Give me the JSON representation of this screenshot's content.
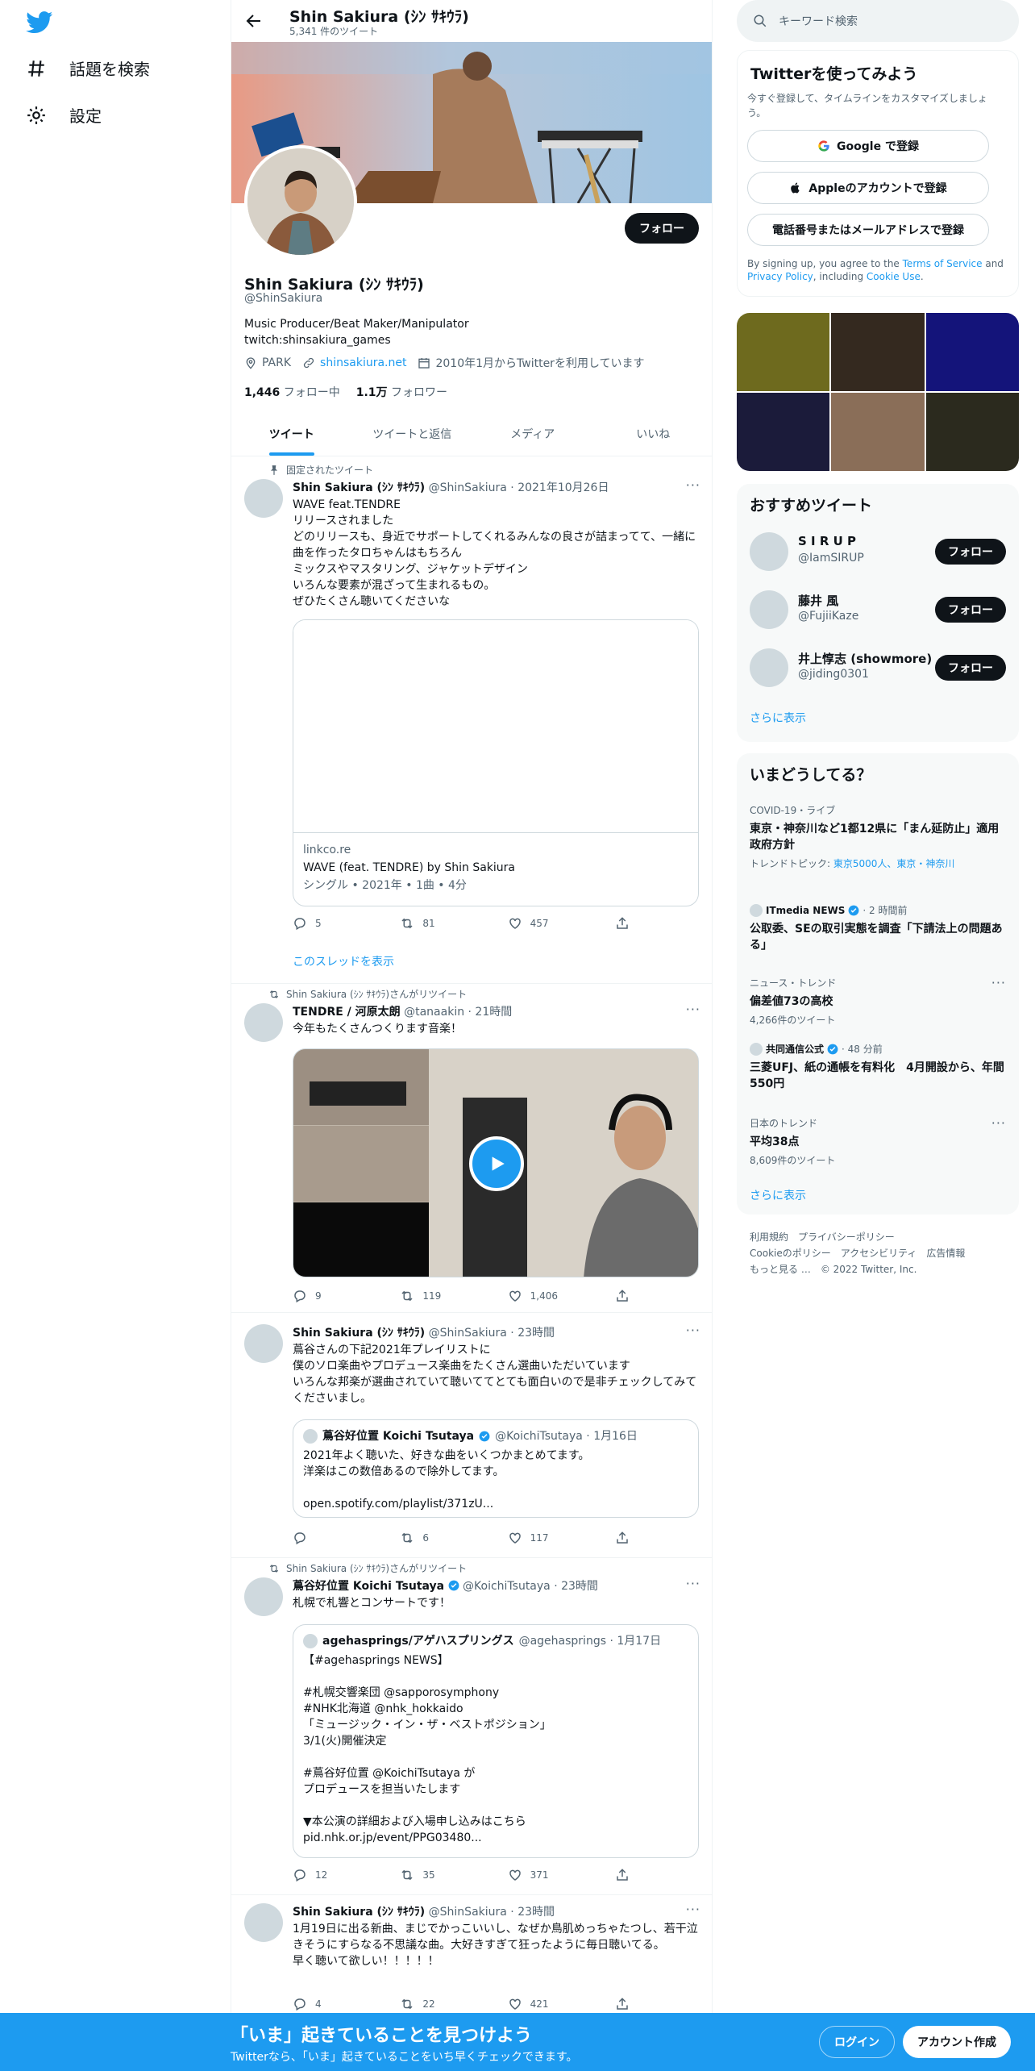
{
  "colors": {
    "accent": "#1d9bf0",
    "dark": "#0f1419",
    "muted": "#536471"
  },
  "left_nav": {
    "items": [
      {
        "label": "話題を検索",
        "icon": "hashtag-icon"
      },
      {
        "label": "設定",
        "icon": "gear-icon"
      }
    ]
  },
  "header": {
    "name": "Shin Sakiura (ｼﾝ ｻｷｳﾗ)",
    "tweet_count": "5,341 件のツイート"
  },
  "profile": {
    "follow_label": "フォロー",
    "name": "Shin Sakiura (ｼﾝ ｻｷｳﾗ)",
    "handle": "@ShinSakiura",
    "bio_line1": "Music Producer/Beat Maker/Manipulator",
    "bio_line2": "twitch:shinsakiura_games",
    "location": "PARK",
    "website": "shinsakiura.net",
    "joined": "2010年1月からTwitterを利用しています",
    "following_count": "1,446",
    "following_label": "フォロー中",
    "followers_count": "1.1万",
    "followers_label": "フォロワー"
  },
  "tabs": [
    "ツイート",
    "ツイートと返信",
    "メディア",
    "いいね"
  ],
  "tweets": [
    {
      "social": "固定されたツイート",
      "name": "Shin Sakiura (ｼﾝ ｻｷｳﾗ)",
      "meta": "@ShinSakiura · 2021年10月26日",
      "text": "WAVE feat.TENDRE\nリリースされました\nどのリリースも、身近でサポートしてくれるみんなの良さが詰まってて、一緒に曲を作ったタロちゃんはもちろん\nミックスやマスタリング、ジャケットデザイン\nいろんな要素が混ざって生まれるもの。\nぜひたくさん聴いてくださいな",
      "card_domain": "linkco.re",
      "card_title": "WAVE (feat. TENDRE) by Shin Sakiura",
      "card_sub": "シングル • 2021年 • 1曲 • 4分",
      "replies": "5",
      "retweets": "81",
      "likes": "457",
      "thread_label": "このスレッドを表示"
    },
    {
      "social": "Shin Sakiura (ｼﾝ ｻｷｳﾗ)さんがリツイート",
      "name": "TENDRE / 河原太朗",
      "meta": "@tanaakin · 21時間",
      "text": "今年もたくさんつくります音楽！",
      "replies": "9",
      "retweets": "119",
      "likes": "1,406"
    },
    {
      "name": "Shin Sakiura (ｼﾝ ｻｷｳﾗ)",
      "meta": "@ShinSakiura · 23時間",
      "text": "蔦谷さんの下記2021年プレイリストに\n僕のソロ楽曲やプロデュース楽曲をたくさん選曲いただいています\nいろんな邦楽が選曲されていて聴いててとても面白いので是非チェックしてみてくださいまし。",
      "quote_name": "蔦谷好位置 Koichi Tsutaya",
      "quote_meta": "@KoichiTsutaya · 1月16日",
      "quote_text": "2021年よく聴いた、好きな曲をいくつかまとめてます。\n洋楽はこの数倍あるので除外してます。\n\nopen.spotify.com/playlist/371zU...",
      "replies": "",
      "retweets": "6",
      "likes": "117"
    },
    {
      "social": "Shin Sakiura (ｼﾝ ｻｷｳﾗ)さんがリツイート",
      "name": "蔦谷好位置 Koichi Tsutaya",
      "meta": "@KoichiTsutaya · 23時間",
      "text": "札幌で札響とコンサートです！",
      "quote_name": "agehasprings/アゲハスプリングス",
      "quote_meta": "@agehasprings · 1月17日",
      "quote_text": "【#agehasprings NEWS】\n\n#札幌交響楽団 @sapporosymphony\n#NHK北海道 @nhk_hokkaido\n「ミュージック・イン・ザ・ベストポジション」\n3/1(火)開催決定\n\n#蔦谷好位置 @KoichiTsutaya が\nプロデュースを担当いたします\n\n▼本公演の詳細および入場申し込みはこちら\npid.nhk.or.jp/event/PPG03480...",
      "replies": "12",
      "retweets": "35",
      "likes": "371"
    },
    {
      "name": "Shin Sakiura (ｼﾝ ｻｷｳﾗ)",
      "meta": "@ShinSakiura · 23時間",
      "text": "1月19日に出る新曲、まじでかっこいいし、なぜか鳥肌めっちゃたつし、若干泣きそうにすらなる不思議な曲。大好きすぎて狂ったように毎日聴いてる。\n早く聴いて欲しい！！！！！",
      "replies": "4",
      "retweets": "22",
      "likes": "421"
    }
  ],
  "right": {
    "search_placeholder": "キーワード検索",
    "signup": {
      "title": "Twitterを使ってみよう",
      "desc": "今すぐ登録して、タイムラインをカスタマイズしましょう。",
      "google": "Google で登録",
      "apple": "Appleのアカウントで登録",
      "phone": "電話番号またはメールアドレスで登録",
      "legal_pre": "By signing up, you agree to the ",
      "tos": "Terms of Service",
      "and": " and ",
      "privacy": "Privacy Policy",
      "including": ", including ",
      "cookie": "Cookie Use",
      "end": "."
    },
    "media_colors": [
      "#6e6a1e",
      "#34291f",
      "#14147a",
      "#1b1b3a",
      "#8a6e58",
      "#2b2a1e"
    ],
    "who_to_follow": {
      "title": "おすすめツイート",
      "users": [
        {
          "name": "S I R U P",
          "handle": "@IamSIRUP",
          "btn": "フォロー"
        },
        {
          "name": "藤井 風",
          "handle": "@FujiiKaze",
          "btn": "フォロー"
        },
        {
          "name": "井上惇志 (showmore)",
          "handle": "@jiding0301",
          "btn": "フォロー"
        }
      ],
      "more": "さらに表示"
    },
    "trends": {
      "title": "いまどうしてる？",
      "items": [
        {
          "ctx": "COVID-19・ライブ",
          "title": "東京・神奈川など1都12県に「まん延防止」適用 政府方針",
          "sub_pre": "トレンドトピック: ",
          "sub_link": "東京5000人、東京・神奈川"
        },
        {
          "ctx": "ITmedia NEWS",
          "ctx_time": " · 2 時間前",
          "title": "公取委、SEの取引実態を調査「下請法上の問題ある」"
        },
        {
          "ctx": "ニュース・トレンド",
          "title": "偏差値73の高校",
          "sub": "4,266件のツイート"
        },
        {
          "ctx": "共同通信公式",
          "ctx_time": " · 48 分前",
          "title": "三菱UFJ、紙の通帳を有料化　4月開設から、年間550円"
        },
        {
          "ctx": "日本のトレンド",
          "title": "平均38点",
          "sub": "8,609件のツイート"
        }
      ],
      "more": "さらに表示"
    },
    "footer": [
      "利用規約",
      "プライバシーポリシー",
      "Cookieのポリシー",
      "アクセシビリティ",
      "広告情報",
      "もっと見る …",
      "© 2022 Twitter, Inc."
    ]
  },
  "bottom_bar": {
    "title": "「いま」起きていることを見つけよう",
    "subtitle": "Twitterなら、「いま」起きていることをいち早くチェックできます。",
    "login": "ログイン",
    "signup": "アカウント作成"
  }
}
